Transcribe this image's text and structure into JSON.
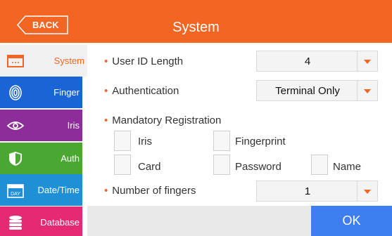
{
  "header": {
    "back_label": "BACK",
    "title": "System"
  },
  "sidebar": {
    "items": [
      {
        "label": "System"
      },
      {
        "label": "Finger"
      },
      {
        "label": "Iris"
      },
      {
        "label": "Auth"
      },
      {
        "label": "Date/Time",
        "icon_text": "DAY"
      },
      {
        "label": "Database"
      }
    ]
  },
  "settings": {
    "user_id_length": {
      "label": "User ID Length",
      "value": "4"
    },
    "authentication": {
      "label": "Authentication",
      "value": "Terminal Only"
    },
    "mandatory_registration": {
      "label": "Mandatory Registration",
      "options": [
        "Iris",
        "Fingerprint",
        "Card",
        "Password",
        "Name"
      ]
    },
    "number_of_fingers": {
      "label": "Number of fingers",
      "value": "1"
    }
  },
  "footer": {
    "ok_label": "OK"
  },
  "colors": {
    "accent": "#f26522",
    "ok": "#3d7ef0"
  }
}
